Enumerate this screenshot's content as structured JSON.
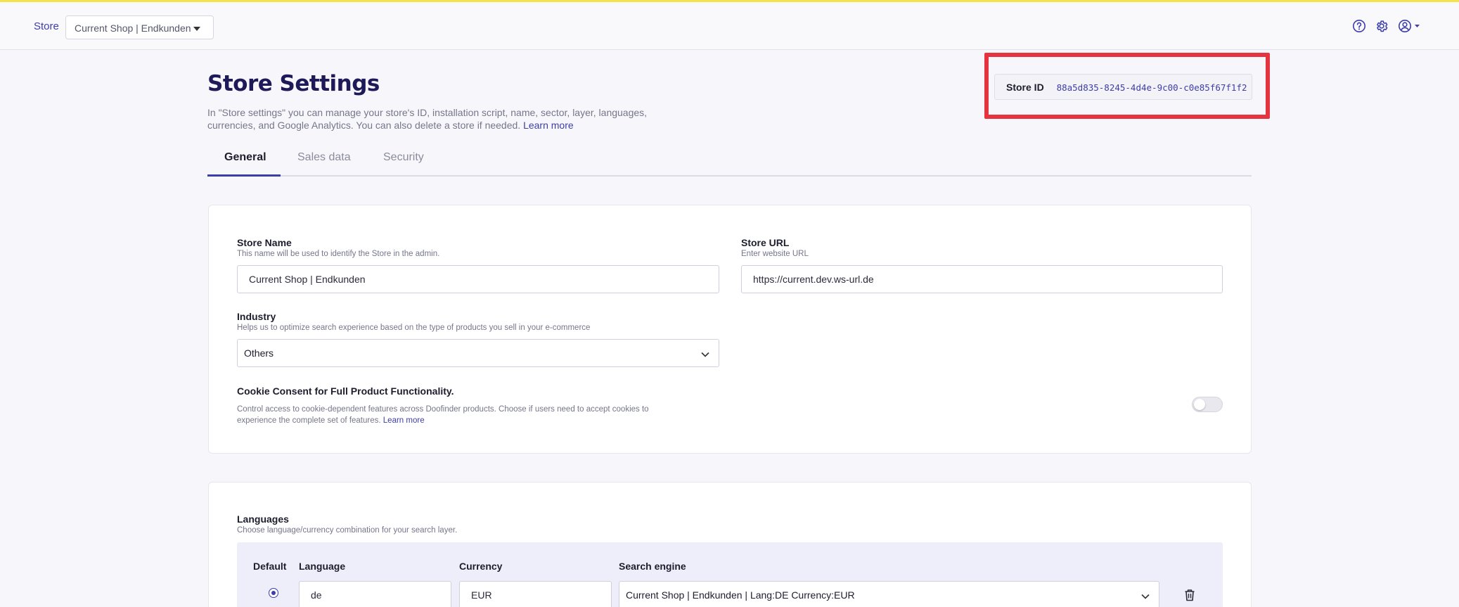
{
  "topbar": {
    "store_label": "Store",
    "store_selector_value": "Current Shop | Endkunden",
    "icons": [
      "help-icon",
      "gear-icon",
      "user-icon"
    ]
  },
  "header": {
    "title": "Store Settings",
    "description": "In \"Store settings\" you can manage your store's ID, installation script, name, sector, layer, languages, currencies, and Google Analytics. You can also delete a store if needed.",
    "learn_more": "Learn more"
  },
  "store_id": {
    "label": "Store ID",
    "value": "88a5d835-8245-4d4e-9c00-c0e85f67f1f2"
  },
  "tabs": [
    {
      "label": "General",
      "active": true
    },
    {
      "label": "Sales data",
      "active": false
    },
    {
      "label": "Security",
      "active": false
    }
  ],
  "general": {
    "store_name": {
      "label": "Store Name",
      "help": "This name will be used to identify the Store in the admin.",
      "value": "Current Shop | Endkunden"
    },
    "store_url": {
      "label": "Store URL",
      "help": "Enter website URL",
      "value": "https://current.dev.ws-url.de"
    },
    "industry": {
      "label": "Industry",
      "help": "Helps us to optimize search experience based on the type of products you sell in your e-commerce",
      "value": "Others"
    },
    "cookie_consent": {
      "label": "Cookie Consent for Full Product Functionality.",
      "description": "Control access to cookie-dependent features across Doofinder products. Choose if users need to accept cookies to experience the complete set of features.",
      "learn_more": "Learn more",
      "enabled": false
    }
  },
  "languages": {
    "label": "Languages",
    "help": "Choose language/currency combination for your search layer.",
    "columns": [
      "Default",
      "Language",
      "Currency",
      "Search engine"
    ],
    "rows": [
      {
        "default": true,
        "language": "de",
        "currency": "EUR",
        "search_engine": "Current Shop | Endkunden | Lang:DE Currency:EUR"
      }
    ]
  },
  "colors": {
    "accent": "#3d3dab",
    "title": "#1e1a5a",
    "highlight": "#e53340",
    "top_accent": "#f3e24a"
  }
}
